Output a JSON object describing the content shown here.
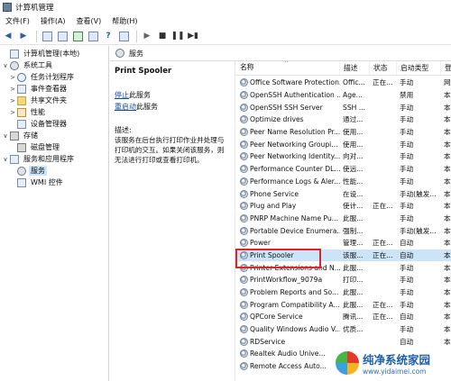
{
  "window": {
    "title": "计算机管理"
  },
  "menu": [
    "文件(F)",
    "操作(A)",
    "查看(V)",
    "帮助(H)"
  ],
  "tree": [
    {
      "label": "计算机管理(本地)",
      "icon": "computer-icon",
      "level": 0,
      "twisty": ""
    },
    {
      "label": "系统工具",
      "icon": "tools-icon",
      "level": 1,
      "twisty": "∨"
    },
    {
      "label": "任务计划程序",
      "icon": "clock-icon",
      "level": 2,
      "twisty": ">"
    },
    {
      "label": "事件查看器",
      "icon": "event-viewer-icon",
      "level": 2,
      "twisty": ">"
    },
    {
      "label": "共享文件夹",
      "icon": "folder-icon",
      "level": 2,
      "twisty": ">"
    },
    {
      "label": "性能",
      "icon": "performance-icon",
      "level": 2,
      "twisty": ">"
    },
    {
      "label": "设备管理器",
      "icon": "device-manager-icon",
      "level": 2,
      "twisty": ""
    },
    {
      "label": "存储",
      "icon": "storage-icon",
      "level": 1,
      "twisty": "∨"
    },
    {
      "label": "磁盘管理",
      "icon": "disk-icon",
      "level": 2,
      "twisty": ""
    },
    {
      "label": "服务和应用程序",
      "icon": "services-apps-icon",
      "level": 1,
      "twisty": "∨"
    },
    {
      "label": "服务",
      "icon": "gear-icon",
      "level": 2,
      "twisty": "",
      "selected": true
    },
    {
      "label": "WMI 控件",
      "icon": "wmi-icon",
      "level": 2,
      "twisty": ""
    }
  ],
  "tab": {
    "label": "服务"
  },
  "detail": {
    "title": "Print Spooler",
    "stop": {
      "link": "停止",
      "rest": "此服务"
    },
    "restart": {
      "link": "重启动",
      "rest": "此服务"
    },
    "desc_label": "描述:",
    "desc_lines": [
      "该服务在后台执行打印作业并处理与",
      "打印机的交互。如果关闭该服务，则",
      "无法进行打印或查看打印机。"
    ]
  },
  "table": {
    "headers": {
      "name": "名称",
      "desc": "描述",
      "status": "状态",
      "start": "启动类型",
      "login": "登"
    },
    "rows": [
      [
        "Office Software Protection...",
        "Offic...",
        "正在...",
        "手动",
        "网"
      ],
      [
        "OpenSSH Authentication ...",
        "Age...",
        "",
        "禁用",
        "本"
      ],
      [
        "OpenSSH SSH Server",
        "SSH ...",
        "",
        "手动",
        "本"
      ],
      [
        "Optimize drives",
        "通过...",
        "",
        "手动",
        "本"
      ],
      [
        "Peer Name Resolution Pr...",
        "使用...",
        "",
        "手动",
        "本"
      ],
      [
        "Peer Networking Groupi...",
        "使用...",
        "",
        "手动",
        "本"
      ],
      [
        "Peer Networking Identity...",
        "向对...",
        "",
        "手动",
        "本"
      ],
      [
        "Performance Counter DL...",
        "使远...",
        "",
        "手动",
        "本"
      ],
      [
        "Performance Logs & Aler...",
        "性能...",
        "",
        "手动",
        "本"
      ],
      [
        "Phone Service",
        "在设...",
        "",
        "手动(触发...",
        "本"
      ],
      [
        "Plug and Play",
        "使计...",
        "正在...",
        "手动",
        "本"
      ],
      [
        "PNRP Machine Name Pu...",
        "此服...",
        "",
        "手动",
        "本"
      ],
      [
        "Portable Device Enumera...",
        "强制...",
        "",
        "手动(触发...",
        "本"
      ],
      [
        "Power",
        "管理...",
        "正在...",
        "自动",
        "本"
      ],
      [
        "Print Spooler",
        "该服...",
        "正在...",
        "自动",
        "本"
      ],
      [
        "Printer Extensions and N...",
        "此服...",
        "",
        "手动",
        "本"
      ],
      [
        "PrintWorkflow_9079a",
        "打印...",
        "",
        "手动",
        "本"
      ],
      [
        "Problem Reports and So...",
        "此服...",
        "",
        "手动",
        "本"
      ],
      [
        "Program Compatibility A...",
        "此服...",
        "正在...",
        "手动",
        "本"
      ],
      [
        "QPCore Service",
        "腾讯...",
        "正在...",
        "自动",
        "本"
      ],
      [
        "Quality Windows Audio V...",
        "优质...",
        "",
        "手动",
        "本"
      ],
      [
        "RDService",
        "",
        "",
        "自动",
        "本"
      ],
      [
        "Realtek Audio Unive...",
        "",
        "",
        "",
        ""
      ],
      [
        "Remote Access Auto...",
        "",
        "",
        "",
        ""
      ]
    ],
    "selected_index": 14,
    "sort_indicator": "^"
  },
  "watermark": {
    "main": "纯净系统家园",
    "url": "www.yidaimei.com"
  },
  "colors": {
    "selection": "#cce4f7",
    "highlight_box": "#d9252c",
    "link": "#1a4fa3"
  }
}
